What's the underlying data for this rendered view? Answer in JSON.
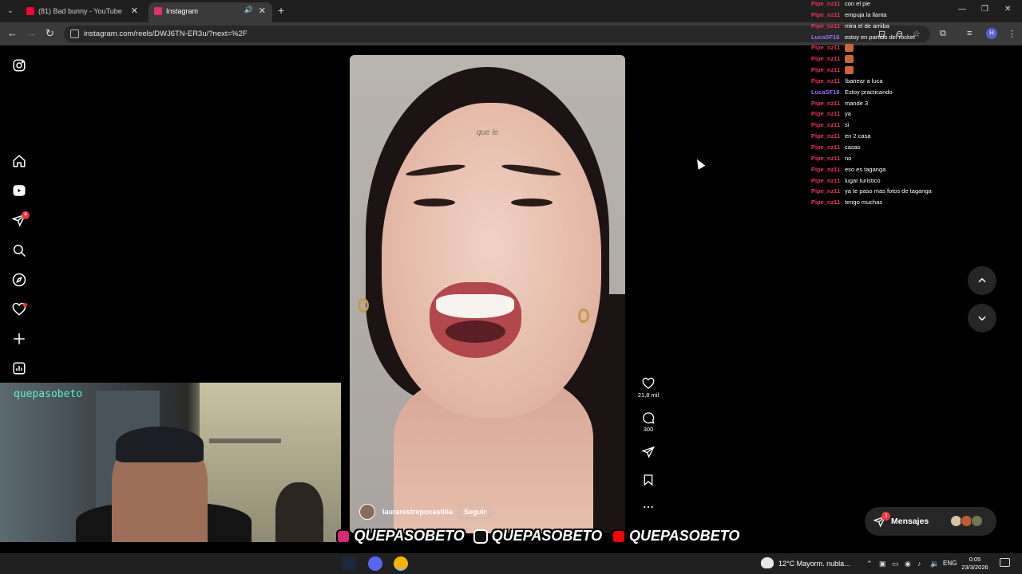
{
  "browser": {
    "tabs": [
      {
        "title": "(81) Bad bunny - YouTube",
        "active": false,
        "favicon_color": "#ff0033"
      },
      {
        "title": "Instagram",
        "active": true,
        "favicon_color": "#e1306c"
      }
    ],
    "url": "instagram.com/reels/DWJ6TN-ER3u/?next=%2F",
    "profile_initial": "H"
  },
  "instagram": {
    "sidebar": [
      {
        "name": "instagram-logo-icon"
      },
      {
        "name": "home-icon"
      },
      {
        "name": "reels-icon"
      },
      {
        "name": "messages-icon",
        "badge": "4"
      },
      {
        "name": "search-icon"
      },
      {
        "name": "explore-icon"
      },
      {
        "name": "notifications-icon"
      },
      {
        "name": "create-icon"
      },
      {
        "name": "dashboard-icon"
      }
    ],
    "reel": {
      "caption_overlay": "que le",
      "username": "laurarestrepocastilla",
      "follow_label": "Seguir",
      "likes": "21,8 mil",
      "comments": "300"
    },
    "messages": {
      "label": "Mensajes",
      "badge": "3"
    }
  },
  "chat": [
    {
      "user": "Pipe_nz11",
      "color": "#e8345a",
      "message": "con el pie"
    },
    {
      "user": "Pipe_nz11",
      "color": "#e8345a",
      "message": "empuja la llanta"
    },
    {
      "user": "Pipe_nz11",
      "color": "#e8345a",
      "message": "mira el de arriiba"
    },
    {
      "user": "LucaSF16",
      "color": "#9b6bff",
      "message": "estoy en partido del rocket"
    },
    {
      "user": "Pipe_nz11",
      "color": "#e8345a",
      "message": "",
      "emote": true
    },
    {
      "user": "Pipe_nz11",
      "color": "#e8345a",
      "message": "",
      "emote": true
    },
    {
      "user": "Pipe_nz11",
      "color": "#e8345a",
      "message": "",
      "emote": true
    },
    {
      "user": "Pipe_nz11",
      "color": "#e8345a",
      "message": "\\banear a luca"
    },
    {
      "user": "LucaSF16",
      "color": "#9b6bff",
      "message": "Estoy practicando"
    },
    {
      "user": "Pipe_nz11",
      "color": "#e8345a",
      "message": "mande 3"
    },
    {
      "user": "Pipe_nz11",
      "color": "#e8345a",
      "message": "ya"
    },
    {
      "user": "Pipe_nz11",
      "color": "#e8345a",
      "message": "si"
    },
    {
      "user": "Pipe_nz11",
      "color": "#e8345a",
      "message": "en 2 casa"
    },
    {
      "user": "Pipe_nz11",
      "color": "#e8345a",
      "message": "casas"
    },
    {
      "user": "Pipe_nz11",
      "color": "#e8345a",
      "message": "no"
    },
    {
      "user": "Pipe_nz11",
      "color": "#e8345a",
      "message": "eso es taganga"
    },
    {
      "user": "Pipe_nz11",
      "color": "#e8345a",
      "message": "lugar turistico"
    },
    {
      "user": "Pipe_nz11",
      "color": "#e8345a",
      "message": "ya te paso mas fotos de taganga"
    },
    {
      "user": "Pipe_nz11",
      "color": "#e8345a",
      "message": "tengo muchas"
    }
  ],
  "webcam": {
    "name": "quepasobeto"
  },
  "socials": [
    {
      "platform": "instagram-icon",
      "handle": "QUEPASOBETO",
      "color": "#d62976"
    },
    {
      "platform": "tiktok-icon",
      "handle": "QUEPASOBETO",
      "color": "#111111"
    },
    {
      "platform": "youtube-icon",
      "handle": "QUEPASOBETO",
      "color": "#ff0000"
    }
  ],
  "taskbar": {
    "apps": [
      {
        "name": "steam-icon",
        "color": "#1b2838"
      },
      {
        "name": "discord-icon",
        "color": "#5865f2"
      },
      {
        "name": "chrome-icon",
        "color": "#f4b400",
        "active": true
      }
    ],
    "weather": "12°C  Mayorm. nubla...",
    "language": "ENG",
    "time": "0:05",
    "date": "23/3/2026"
  }
}
